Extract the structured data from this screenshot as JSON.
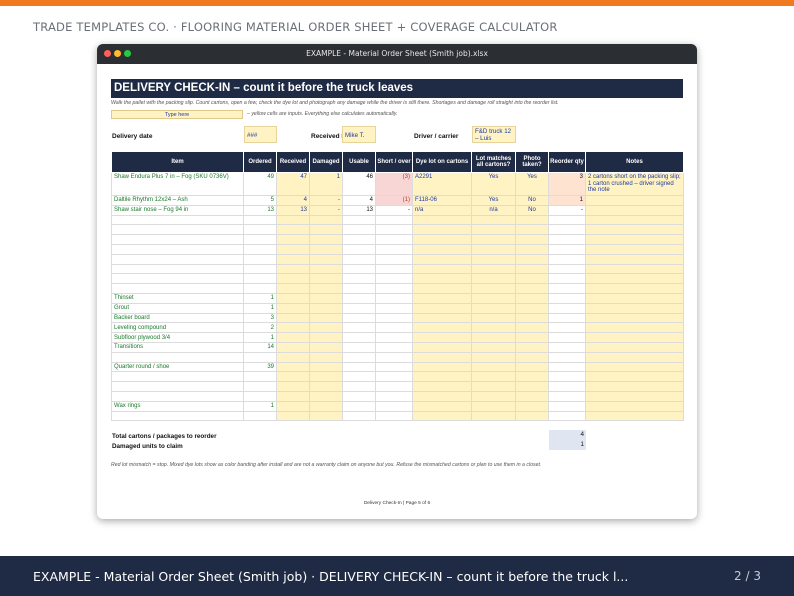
{
  "header": {
    "brand": "TRADE TEMPLATES CO.  ·  FLOORING MATERIAL ORDER SHEET + COVERAGE CALCULATOR"
  },
  "window": {
    "title": "EXAMPLE - Material Order Sheet (Smith job).xlsx"
  },
  "sheet": {
    "banner": "DELIVERY CHECK-IN – count it before the truck leaves",
    "instructions": "Walk the pallet with the packing slip. Count cartons, open a few, check the dye lot and photograph any damage while the driver is still there. Shortages and damage roll straight into the reorder list.",
    "legend_label": "Type here",
    "legend_note": "– yellow cells are inputs. Everything else calculates automatically.",
    "delivery_date_label": "Delivery date",
    "delivery_date_value": "###",
    "received_by_label": "Received by",
    "received_by_value": "Mike T.",
    "driver_label": "Driver / carrier",
    "driver_value": "F&D truck 12 – Luis",
    "columns": [
      "Item",
      "Ordered",
      "Received",
      "Damaged",
      "Usable",
      "Short / over",
      "Dye lot on cartons",
      "Lot matches all cartons?",
      "Photo taken?",
      "Reorder qty",
      "Notes"
    ],
    "rows": [
      {
        "item": "Shaw Endura Plus 7 in – Fog (SKU 0736V)",
        "ordered": "49",
        "received": "47",
        "damaged": "1",
        "usable": "46",
        "short": "(3)",
        "dyelot": "A2291",
        "lot": "Yes",
        "photo": "Yes",
        "reorder": "3",
        "notes": "2 cartons short on the packing slip; 1 carton crushed – driver signed the note"
      },
      {
        "item": "Daltile Rhythm 12x24 – Ash",
        "ordered": "5",
        "received": "4",
        "damaged": "-",
        "usable": "4",
        "short": "(1)",
        "dyelot": "F118-06",
        "lot": "Yes",
        "photo": "No",
        "reorder": "1",
        "notes": ""
      },
      {
        "item": "Shaw stair nose – Fog 94 in",
        "ordered": "13",
        "received": "13",
        "damaged": "-",
        "usable": "13",
        "short": "-",
        "dyelot": "n/a",
        "lot": "n/a",
        "photo": "No",
        "reorder": "-",
        "notes": ""
      },
      {
        "item": "",
        "ordered": ""
      },
      {
        "item": "",
        "ordered": ""
      },
      {
        "item": "",
        "ordered": ""
      },
      {
        "item": "",
        "ordered": ""
      },
      {
        "item": "",
        "ordered": ""
      },
      {
        "item": "",
        "ordered": ""
      },
      {
        "item": "",
        "ordered": ""
      },
      {
        "item": "",
        "ordered": ""
      },
      {
        "item": "Thinset",
        "ordered": "1"
      },
      {
        "item": "Grout",
        "ordered": "1"
      },
      {
        "item": "Backer board",
        "ordered": "3"
      },
      {
        "item": "Leveling compound",
        "ordered": "2"
      },
      {
        "item": "Subfloor plywood 3/4",
        "ordered": "1"
      },
      {
        "item": "Transitions",
        "ordered": "14"
      },
      {
        "item": "",
        "ordered": ""
      },
      {
        "item": "Quarter round / shoe",
        "ordered": "39"
      },
      {
        "item": "",
        "ordered": ""
      },
      {
        "item": "",
        "ordered": ""
      },
      {
        "item": "",
        "ordered": ""
      },
      {
        "item": "Wax rings",
        "ordered": "1"
      },
      {
        "item": "",
        "ordered": ""
      }
    ],
    "totals": {
      "cartons_label": "Total cartons / packages to reorder",
      "cartons_value": "4",
      "damaged_label": "Damaged units to claim",
      "damaged_value": "1"
    },
    "footnote": "Red lot mismatch = stop. Mixed dye lots show as color banding after install and are not a warranty claim on anyone but you. Refuse the mismatched cartons or plan to use them in a closet.",
    "page_footer": "Delivery Check-In  |  Page 5 of 6"
  },
  "footer": {
    "title": "EXAMPLE - Material Order Sheet (Smith job) · DELIVERY CHECK-IN – count it before the truck l...",
    "page": "2 / 3"
  },
  "colors": {
    "accent": "#f07a1f",
    "navy": "#1f2a44",
    "input": "#fff3c4"
  }
}
